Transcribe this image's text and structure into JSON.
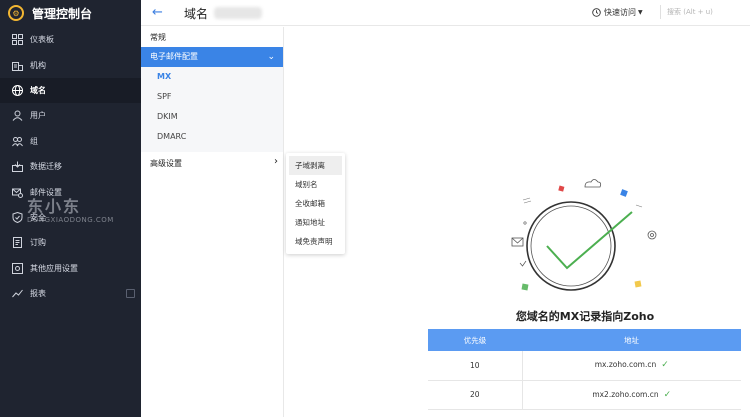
{
  "sidebar": {
    "brand": "管理控制台",
    "items": [
      {
        "label": "仪表板",
        "icon": "dashboard-icon"
      },
      {
        "label": "机构",
        "icon": "organization-icon"
      },
      {
        "label": "域名",
        "icon": "globe-icon"
      },
      {
        "label": "用户",
        "icon": "user-icon"
      },
      {
        "label": "组",
        "icon": "group-icon"
      },
      {
        "label": "数据迁移",
        "icon": "migration-icon"
      },
      {
        "label": "邮件设置",
        "icon": "mail-settings-icon"
      },
      {
        "label": "安全",
        "icon": "shield-icon"
      },
      {
        "label": "订购",
        "icon": "subscription-icon"
      },
      {
        "label": "其他应用设置",
        "icon": "apps-settings-icon"
      },
      {
        "label": "报表",
        "icon": "reports-icon"
      }
    ],
    "active_index": 2,
    "watermark_big": "东小东",
    "watermark_small": "DONGXIAODONG.COM"
  },
  "header": {
    "back_icon": "arrow-left-icon",
    "title": "域名",
    "quick_access": "快速访问",
    "search_placeholder": "搜索 (Alt + u)"
  },
  "subnav": {
    "general": "常规",
    "mail_config": "电子邮件配置",
    "mail_items": [
      "MX",
      "SPF",
      "DKIM",
      "DMARC"
    ],
    "active_mail_item": "MX",
    "advanced": "高级设置"
  },
  "flyout": {
    "items": [
      "子域剥离",
      "域别名",
      "全收邮箱",
      "通知地址",
      "域免责声明"
    ],
    "hover_index": 0
  },
  "main": {
    "heading": "您域名的MX记录指向Zoho",
    "table": {
      "headers": [
        "优先级",
        "地址"
      ],
      "rows": [
        {
          "priority": "10",
          "address": "mx.zoho.com.cn"
        },
        {
          "priority": "20",
          "address": "mx2.zoho.com.cn"
        }
      ]
    }
  },
  "colors": {
    "accent": "#3a84e6",
    "sidebar_bg": "#1f2430",
    "success": "#4caf50",
    "table_header": "#5b9bf2"
  }
}
